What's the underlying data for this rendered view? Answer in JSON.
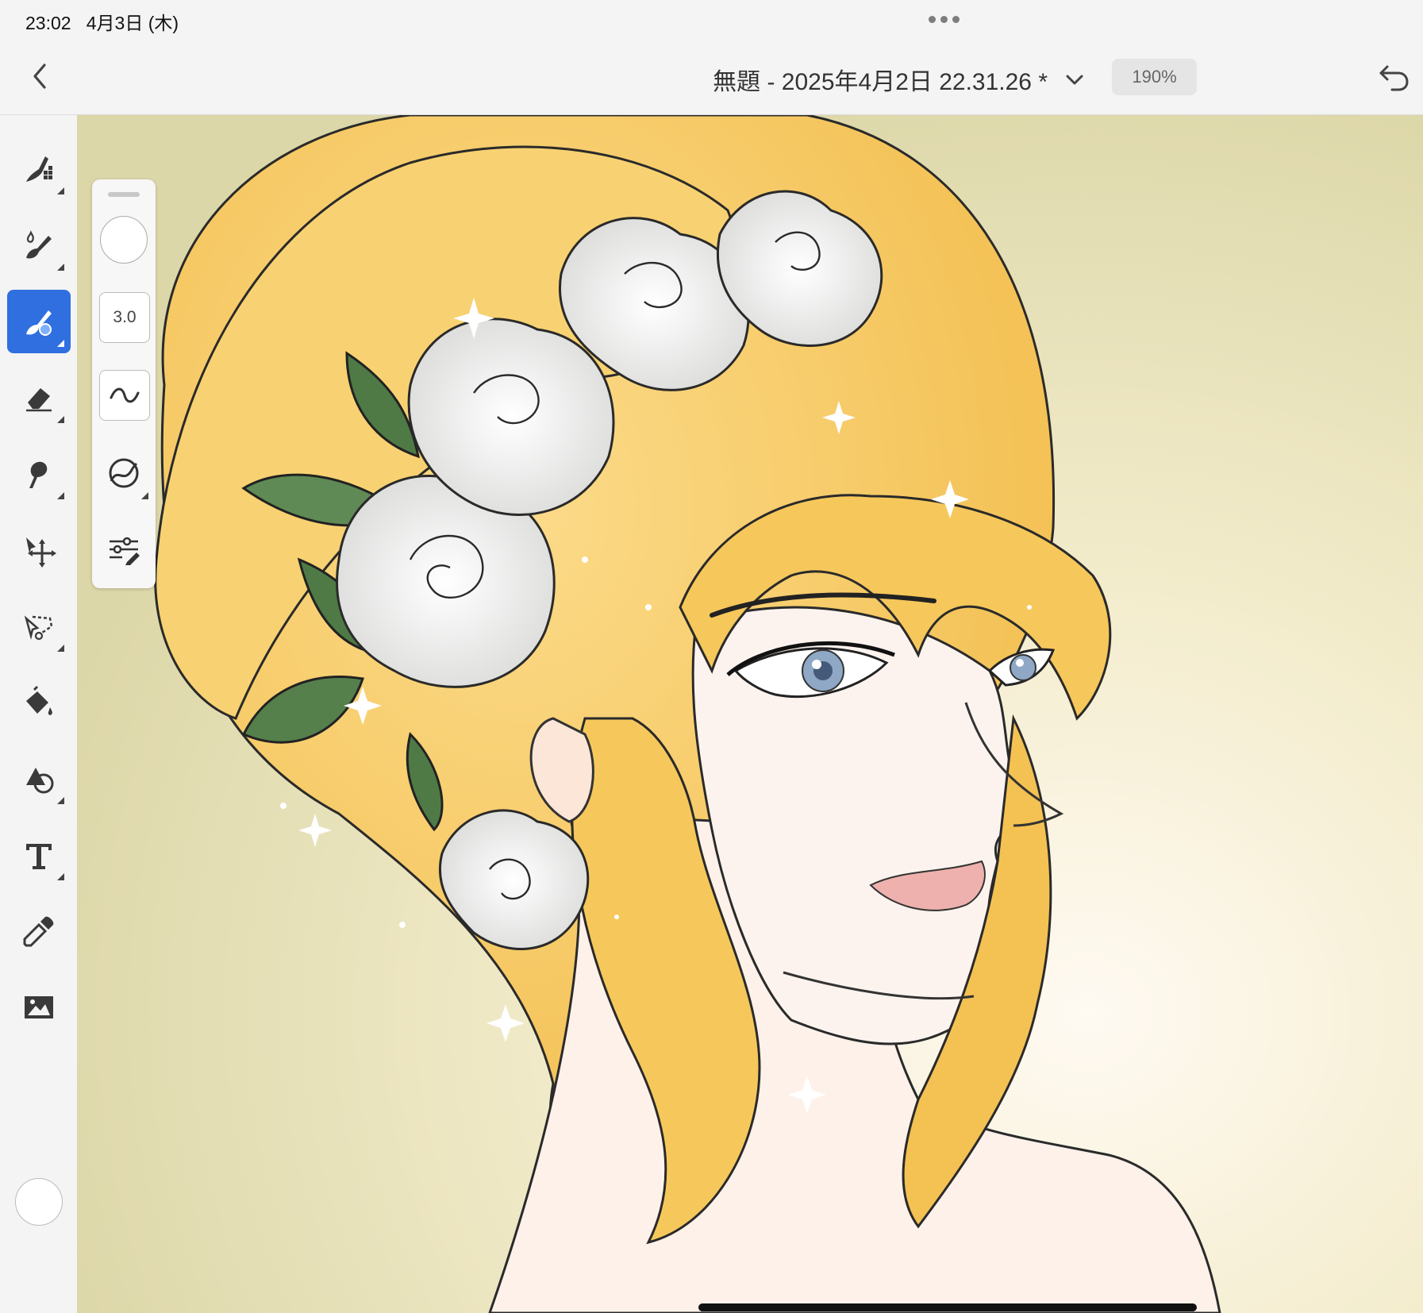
{
  "status_bar": {
    "time": "23:02",
    "date": "4月3日 (木)"
  },
  "header": {
    "back_icon": "chevron-left-icon",
    "title": "無題 - 2025年4月2日 22.31.26 *",
    "title_menu_icon": "chevron-down-icon",
    "zoom": "190%",
    "undo_icon": "undo-icon"
  },
  "toolbar": {
    "tools": [
      {
        "name": "pixel-brush-icon",
        "has_submenu": true
      },
      {
        "name": "live-brush-icon",
        "has_submenu": true
      },
      {
        "name": "vector-brush-icon",
        "has_submenu": true,
        "active": true
      },
      {
        "name": "eraser-icon",
        "has_submenu": true
      },
      {
        "name": "smudge-icon",
        "has_submenu": true
      },
      {
        "name": "move-transform-icon",
        "has_submenu": false
      },
      {
        "name": "lasso-selection-icon",
        "has_submenu": true
      },
      {
        "name": "fill-bucket-icon",
        "has_submenu": false
      },
      {
        "name": "shapes-icon",
        "has_submenu": true
      },
      {
        "name": "text-icon",
        "has_submenu": true
      },
      {
        "name": "eyedropper-icon",
        "has_submenu": false
      },
      {
        "name": "place-image-icon",
        "has_submenu": false
      }
    ],
    "current_color": "#ffffff",
    "active_color": "#2f6fe0"
  },
  "brush_panel": {
    "swatch_color": "#ffffff",
    "size": "3.0",
    "smoothing_icon": "smoothing-icon",
    "pressure_icon": "pressure-dynamics-icon",
    "settings_icon": "brush-settings-icon"
  }
}
